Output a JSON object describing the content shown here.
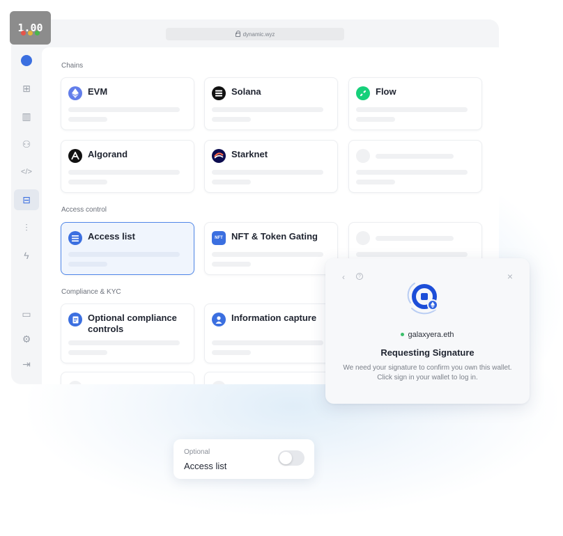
{
  "zoom_level": "1.00",
  "browser": {
    "url": "dynamic.wyz"
  },
  "sidebar": {
    "items": [
      {
        "icon": "logo-dot-icon",
        "glyph": ""
      },
      {
        "icon": "grid-icon",
        "glyph": "⊞"
      },
      {
        "icon": "chart-bar-icon",
        "glyph": "▥"
      },
      {
        "icon": "users-icon",
        "glyph": "⚇"
      },
      {
        "icon": "code-icon",
        "glyph": "</>"
      },
      {
        "icon": "box-icon",
        "glyph": "⊟"
      },
      {
        "icon": "sliders-icon",
        "glyph": "⫶"
      },
      {
        "icon": "lightning-icon",
        "glyph": "ϟ"
      },
      {
        "icon": "book-icon",
        "glyph": "▭"
      },
      {
        "icon": "gear-icon",
        "glyph": "⚙"
      },
      {
        "icon": "logout-icon",
        "glyph": "⇥"
      }
    ]
  },
  "sections": {
    "chains": "Chains",
    "access_control": "Access control",
    "compliance": "Compliance & KYC"
  },
  "chains": [
    {
      "label": "EVM",
      "icon": "ethereum-icon",
      "color": "#627EEA"
    },
    {
      "label": "Solana",
      "icon": "solana-icon",
      "color": "#111111"
    },
    {
      "label": "Flow",
      "icon": "flow-icon",
      "color": "#16D07A"
    },
    {
      "label": "Algorand",
      "icon": "algorand-icon",
      "color": "#111111"
    },
    {
      "label": "Starknet",
      "icon": "starknet-icon",
      "color": "#0C0C4F"
    }
  ],
  "access_control": [
    {
      "label": "Access list",
      "icon": "list-icon",
      "color": "#3B6FE0",
      "selected": true
    },
    {
      "label": "NFT & Token Gating",
      "icon": "nft-icon",
      "color": "#3B6FE0"
    }
  ],
  "compliance": [
    {
      "label": "Optional compliance controls",
      "icon": "document-icon",
      "color": "#3B6FE0"
    },
    {
      "label": "Information capture",
      "icon": "user-icon",
      "color": "#3B6FE0"
    }
  ],
  "modal": {
    "wallet_name": "galaxyera.eth",
    "title": "Requesting Signature",
    "description": "We need your signature to confirm you own this wallet. Click sign in your wallet to log in."
  },
  "toggle": {
    "sub_label": "Optional",
    "main_label": "Access list",
    "checked": false
  },
  "colors": {
    "accent": "#3B6FE0",
    "online": "#3BBF6B"
  }
}
